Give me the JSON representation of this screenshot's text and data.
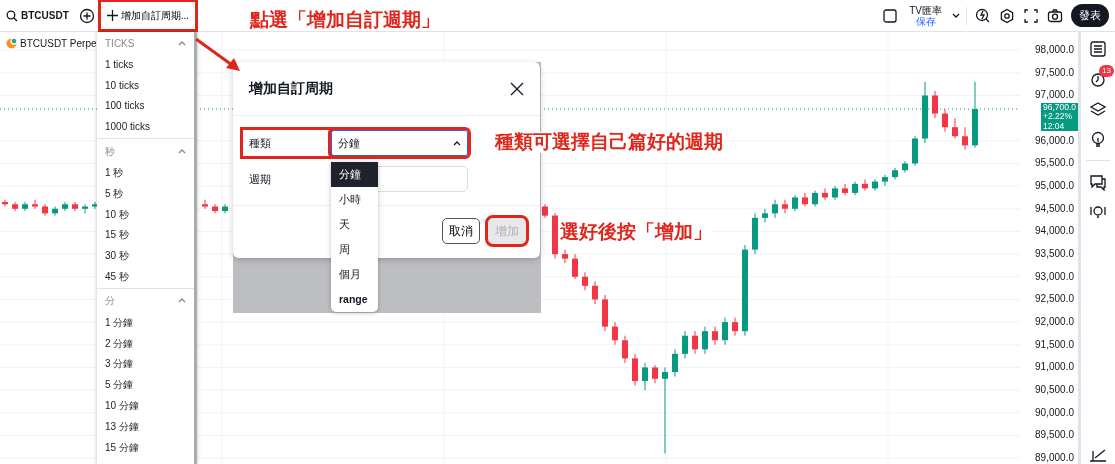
{
  "top_bar": {
    "symbol": "BTCUSDT",
    "custom_interval_button": {
      "label": "增加自訂周期...",
      "highlighted": true
    },
    "currency": {
      "label": "TV匯率",
      "sub": "保存"
    },
    "publish_button": "發表"
  },
  "legend": {
    "symbol": "BTCUSDT Perpe"
  },
  "chart": {
    "chart_data": {
      "type": "candlestick",
      "categories": [
        null,
        null,
        null,
        null,
        null,
        null,
        null,
        null,
        null,
        null,
        null,
        null,
        null,
        null,
        null,
        null,
        null,
        null,
        null,
        null,
        null,
        null,
        null,
        null,
        null,
        null,
        null,
        null,
        null,
        null,
        null,
        null,
        null,
        null,
        null,
        null,
        null,
        null,
        null,
        null,
        null,
        null,
        null,
        null,
        null,
        null,
        null,
        null,
        null,
        null,
        null,
        null,
        null,
        null,
        null,
        null,
        null,
        null,
        null,
        null,
        null,
        null,
        null,
        null,
        null,
        null,
        null,
        null,
        null,
        null,
        null,
        null,
        null,
        null,
        null,
        null,
        null,
        null,
        null,
        null,
        null,
        null,
        null,
        null,
        null,
        null,
        null,
        null,
        null,
        null,
        null,
        null,
        null,
        null,
        null,
        null,
        null,
        null,
        null,
        null,
        null,
        null
      ],
      "ohlc": [
        [
          94650,
          94700,
          94550,
          94600
        ],
        [
          94600,
          94650,
          94450,
          94500
        ],
        [
          94500,
          94650,
          94450,
          94600
        ],
        [
          94600,
          94700,
          94500,
          94550
        ],
        [
          94550,
          94600,
          94350,
          94400
        ],
        [
          94400,
          94550,
          94350,
          94500
        ],
        [
          94500,
          94650,
          94450,
          94600
        ],
        [
          94600,
          94650,
          94450,
          94500
        ],
        [
          94500,
          94600,
          94400,
          94550
        ],
        [
          94550,
          94650,
          94500,
          94600
        ],
        null,
        null,
        null,
        null,
        null,
        null,
        null,
        null,
        null,
        null,
        [
          94600,
          94700,
          94500,
          94550
        ],
        [
          94550,
          94600,
          94400,
          94450
        ],
        [
          94450,
          94600,
          94400,
          94550
        ],
        null,
        null,
        null,
        null,
        null,
        null,
        null,
        null,
        null,
        null,
        null,
        null,
        null,
        null,
        null,
        null,
        null,
        null,
        null,
        null,
        null,
        null,
        null,
        null,
        null,
        null,
        null,
        null,
        null,
        null,
        null,
        [
          94550,
          94600,
          94300,
          94350
        ],
        [
          94350,
          94400,
          93400,
          93500
        ],
        [
          93500,
          93600,
          93300,
          93400
        ],
        [
          93400,
          93500,
          92950,
          93000
        ],
        [
          93000,
          93100,
          92700,
          92800
        ],
        [
          92800,
          92900,
          92400,
          92500
        ],
        [
          92500,
          92600,
          91800,
          91900
        ],
        [
          91900,
          92000,
          91500,
          91600
        ],
        [
          91600,
          91700,
          91100,
          91200
        ],
        [
          91200,
          91300,
          90600,
          90700
        ],
        [
          90700,
          91100,
          90500,
          91000
        ],
        [
          91000,
          91050,
          90650,
          90750
        ],
        [
          90750,
          91000,
          89100,
          90900
        ],
        [
          90900,
          91400,
          90800,
          91300
        ],
        [
          91300,
          91800,
          91200,
          91700
        ],
        [
          91700,
          91800,
          91300,
          91400
        ],
        [
          91400,
          91900,
          91300,
          91800
        ],
        [
          91800,
          91900,
          91500,
          91600
        ],
        [
          91600,
          92100,
          91500,
          92000
        ],
        [
          92000,
          92100,
          91700,
          91800
        ],
        [
          91800,
          93700,
          91700,
          93600
        ],
        [
          93600,
          94400,
          93500,
          94300
        ],
        [
          94300,
          94500,
          94200,
          94400
        ],
        [
          94400,
          94700,
          94300,
          94600
        ],
        [
          94600,
          94700,
          94400,
          94500
        ],
        [
          94500,
          94800,
          94450,
          94750
        ],
        [
          94750,
          94850,
          94550,
          94600
        ],
        [
          94600,
          94900,
          94550,
          94850
        ],
        [
          94850,
          94950,
          94700,
          94750
        ],
        [
          94750,
          95000,
          94700,
          94950
        ],
        [
          94950,
          95050,
          94800,
          94850
        ],
        [
          94850,
          95100,
          94800,
          95050
        ],
        [
          95050,
          95150,
          94900,
          94950
        ],
        [
          94950,
          95150,
          94900,
          95100
        ],
        [
          95100,
          95250,
          95000,
          95200
        ],
        [
          95200,
          95400,
          95150,
          95350
        ],
        [
          95350,
          95550,
          95300,
          95500
        ],
        [
          95500,
          96100,
          95450,
          96050
        ],
        [
          96050,
          97300,
          95950,
          97000
        ],
        [
          97000,
          97100,
          96500,
          96600
        ],
        [
          96600,
          96700,
          96200,
          96300
        ],
        [
          96300,
          96500,
          96050,
          96100
        ],
        [
          96100,
          96300,
          95800,
          95900
        ],
        [
          95900,
          97300,
          95850,
          96700
        ],
        null,
        null,
        null,
        null
      ],
      "ylim": [
        88870,
        98400
      ],
      "grid": true,
      "ref_lines": [
        {
          "axis": "y",
          "value": 96700,
          "color": "#089981"
        }
      ],
      "yticks": [
        {
          "value": 98000,
          "label": "98,000.0"
        },
        {
          "value": 97500,
          "label": "97,500.0"
        },
        {
          "value": 97000,
          "label": "97,000.0"
        },
        {
          "value": 96000,
          "label": "96,000.0"
        },
        {
          "value": 95500,
          "label": "95,500.0"
        },
        {
          "value": 95000,
          "label": "95,000.0"
        },
        {
          "value": 94500,
          "label": "94,500.0"
        },
        {
          "value": 94000,
          "label": "94,000.0"
        },
        {
          "value": 93500,
          "label": "93,500.0"
        },
        {
          "value": 93000,
          "label": "93,000.0"
        },
        {
          "value": 92500,
          "label": "92,500.0"
        },
        {
          "value": 92000,
          "label": "92,000.0"
        },
        {
          "value": 91500,
          "label": "91,500.0"
        },
        {
          "value": 91000,
          "label": "91,000.0"
        },
        {
          "value": 90500,
          "label": "90,500.0"
        },
        {
          "value": 90000,
          "label": "90,000.0"
        },
        {
          "value": 89500,
          "label": "89,500.0"
        },
        {
          "value": 89000,
          "label": "89,000.0"
        }
      ]
    }
  },
  "interval_menu": {
    "sections": [
      {
        "title": "TICKS",
        "expanded": true,
        "items": [
          "1 ticks",
          "10 ticks",
          "100 ticks",
          "1000 ticks"
        ]
      },
      {
        "title": "秒",
        "expanded": true,
        "items": [
          "1 秒",
          "5 秒",
          "10 秒",
          "15 秒",
          "30 秒",
          "45 秒"
        ]
      },
      {
        "title": "分",
        "expanded": true,
        "items": [
          "1 分鐘",
          "2 分鐘",
          "3 分鐘",
          "5 分鐘",
          "10 分鐘",
          "13 分鐘",
          "15 分鐘"
        ]
      }
    ]
  },
  "dialog": {
    "title": "增加自訂周期",
    "fields": [
      {
        "label": "種類",
        "kind": "select",
        "value": "分鐘",
        "expanded": true,
        "highlighted": true
      },
      {
        "label": "週期",
        "kind": "input"
      }
    ],
    "options": [
      {
        "label": "分鐘",
        "selected": true
      },
      {
        "label": "小時",
        "selected": false
      },
      {
        "label": "天",
        "selected": false
      },
      {
        "label": "周",
        "selected": false
      },
      {
        "label": "個月",
        "selected": false
      },
      {
        "label": "range",
        "selected": false
      }
    ],
    "buttons": [
      {
        "label": "取消",
        "kind": "secondary",
        "disabled": false,
        "highlighted": false
      },
      {
        "label": "增加",
        "kind": "primary",
        "disabled": true,
        "highlighted": true
      }
    ]
  },
  "last_price": {
    "price": "96,700.0",
    "change": "+2.22%",
    "countdown": "12:04"
  },
  "right_toolbar": {
    "alerts_badge": "13"
  },
  "annotations": [
    {
      "text": "點選「增加自訂週期」"
    },
    {
      "text": "種類可選擇自己篇好的週期"
    },
    {
      "text": "選好後按「增加」"
    }
  ]
}
